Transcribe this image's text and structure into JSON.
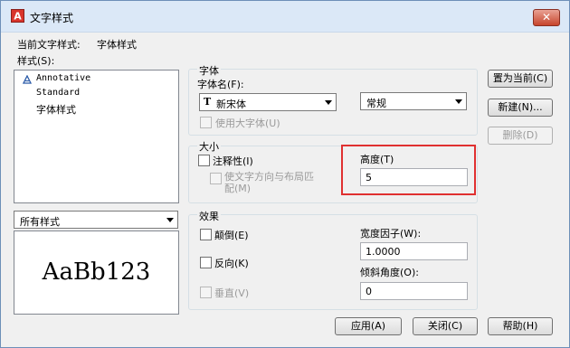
{
  "window": {
    "title": "文字样式",
    "close_symbol": "✕"
  },
  "current_style": {
    "label": "当前文字样式:",
    "value": "字体样式"
  },
  "styles": {
    "label": "样式(S):",
    "items": [
      "Annotative",
      "Standard",
      "字体样式"
    ],
    "filter_value": "所有样式"
  },
  "preview": {
    "text": "AaBb123"
  },
  "font": {
    "group_label": "字体",
    "name_label": "字体名(F):",
    "name_value": "新宋体",
    "name_icon": "truetype-font-icon",
    "style_value": "常规",
    "big_font_label": "使用大字体(U)"
  },
  "size": {
    "group_label": "大小",
    "annotative_label": "注释性(I)",
    "match_layout_label": "使文字方向与布局匹配(M)",
    "height_label": "高度(T)",
    "height_value": "5"
  },
  "effects": {
    "group_label": "效果",
    "upside_down_label": "颠倒(E)",
    "backwards_label": "反向(K)",
    "vertical_label": "垂直(V)",
    "width_factor_label": "宽度因子(W):",
    "width_factor_value": "1.0000",
    "oblique_label": "倾斜角度(O):",
    "oblique_value": "0"
  },
  "buttons": {
    "set_current": "置为当前(C)",
    "new": "新建(N)...",
    "delete": "删除(D)",
    "apply": "应用(A)",
    "close": "关闭(C)",
    "help": "帮助(H)"
  },
  "colors": {
    "highlight_box": "#e03030",
    "title_bar": "#dbe8f7"
  }
}
